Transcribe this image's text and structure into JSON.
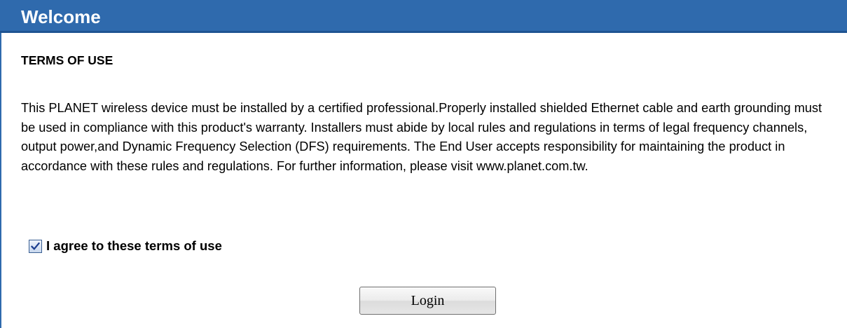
{
  "window": {
    "title": "Welcome"
  },
  "terms": {
    "heading": "TERMS OF USE",
    "body": "This PLANET wireless device must be installed by a certified professional.Properly installed shielded Ethernet cable and earth grounding must be used in compliance with this product's warranty. Installers must abide by local rules and regulations in terms of legal frequency channels, output power,and Dynamic Frequency Selection (DFS) requirements. The End User accepts responsibility for maintaining the product in accordance with these rules and regulations. For further information, please visit www.planet.com.tw."
  },
  "agreement": {
    "label": "I agree to these terms of use",
    "checked": true
  },
  "actions": {
    "login_label": "Login"
  },
  "colors": {
    "title_bar": "#2f6aad",
    "checkmark": "#1b3d8f"
  }
}
